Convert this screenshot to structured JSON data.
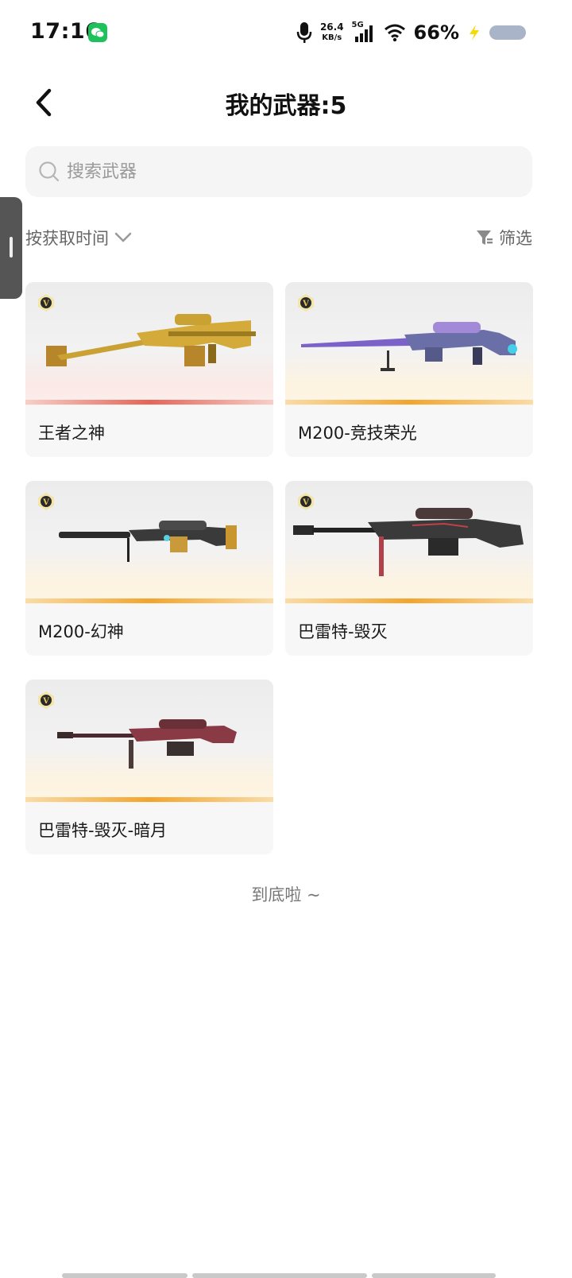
{
  "status_bar": {
    "time": "17:16",
    "net_speed_value": "26.4",
    "net_speed_unit": "KB/s",
    "network_type": "5G",
    "battery_percent": "66%",
    "icons": [
      "wechat-icon",
      "mic-icon",
      "signal-icon",
      "wifi-icon",
      "charging-icon",
      "battery-icon"
    ]
  },
  "header": {
    "title": "我的武器:5"
  },
  "search": {
    "placeholder": "搜索武器"
  },
  "sort": {
    "label": "按获取时间"
  },
  "filter": {
    "label": "筛选"
  },
  "weapons": [
    {
      "name": "王者之神",
      "badge": "V",
      "accent": "#e56458"
    },
    {
      "name": "M200-竞技荣光",
      "badge": "V",
      "accent": "#f2a52f"
    },
    {
      "name": "M200-幻神",
      "badge": "V",
      "accent": "#f2a52f"
    },
    {
      "name": "巴雷特-毁灭",
      "badge": "V",
      "accent": "#f2a52f"
    },
    {
      "name": "巴雷特-毁灭-暗月",
      "badge": "V",
      "accent": "#f2a52f"
    }
  ],
  "footer": {
    "end_text": "到底啦 ~"
  }
}
